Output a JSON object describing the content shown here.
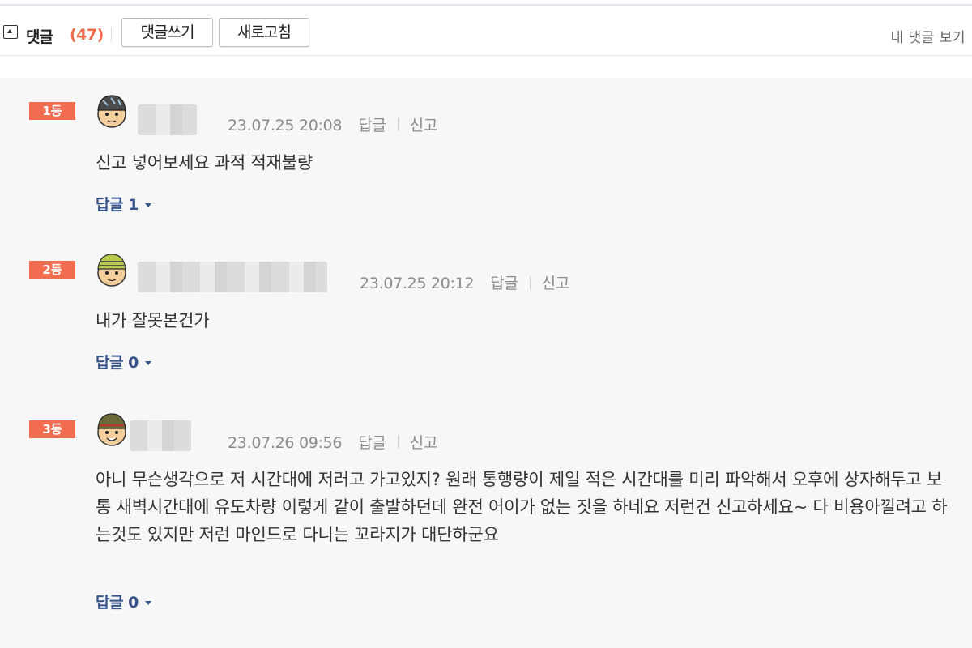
{
  "header": {
    "title": "댓글",
    "count": "(47)",
    "write_button": "댓글쓰기",
    "refresh_button": "새로고침",
    "my_comments": "내 댓글 보기"
  },
  "comments": [
    {
      "rank": "1등",
      "timestamp": "23.07.25 20:08",
      "reply_action": "답글",
      "report_action": "신고",
      "text": "신고 넣어보세요 과적 적재불량",
      "reply_toggle": "답글 1",
      "avatar_icon": "character-avatar-icon"
    },
    {
      "rank": "2등",
      "timestamp": "23.07.25 20:12",
      "reply_action": "답글",
      "report_action": "신고",
      "text": "내가 잘못본건가",
      "reply_toggle": "답글 0",
      "avatar_icon": "character-avatar-icon"
    },
    {
      "rank": "3등",
      "timestamp": "23.07.26 09:56",
      "reply_action": "답글",
      "report_action": "신고",
      "text": "아니 무슨생각으로 저 시간대에 저러고 가고있지? 원래 통행량이 제일 적은 시간대를 미리 파악해서 오후에 상자해두고 보통 새벽시간대에 유도차량 이렇게 같이 출발하던데 완전 어이가 없는 짓을 하네요 저런건 신고하세요~ 다 비용아낄려고 하는것도 있지만 저런 마인드로 다니는 꼬라지가 대단하군요",
      "reply_toggle": "답글 0",
      "avatar_icon": "character-avatar-icon"
    }
  ],
  "colors": {
    "accent": "#f26c4f",
    "reply_link": "#36548a",
    "list_background": "#f7f7f7"
  }
}
